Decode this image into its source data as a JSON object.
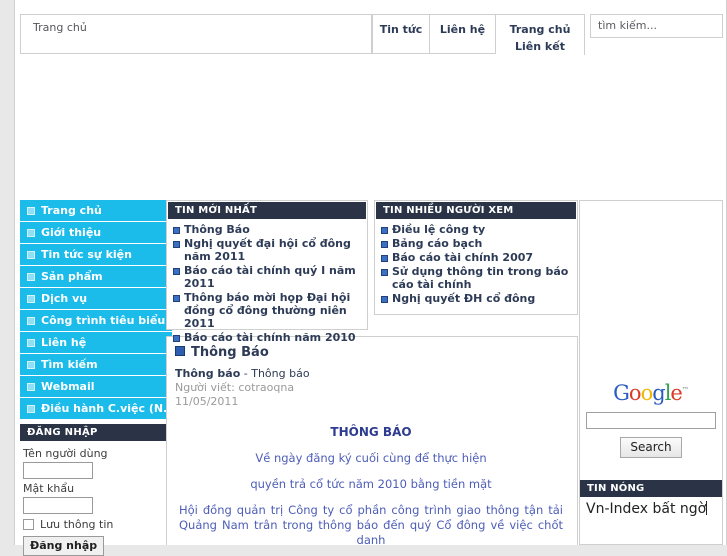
{
  "topbar": {
    "breadcrumb": "Trang chủ",
    "nav": [
      {
        "label": "Tin tức"
      },
      {
        "label": "Liên hệ"
      },
      {
        "label": "Trang chủ"
      },
      {
        "label": "Liên kết"
      }
    ],
    "search_placeholder": "tìm kiếm..."
  },
  "sidebar": {
    "items": [
      {
        "label": "Trang chủ"
      },
      {
        "label": "Giới thiệu"
      },
      {
        "label": "Tin tức sự kiện"
      },
      {
        "label": "Sản phẩm"
      },
      {
        "label": "Dịch vụ"
      },
      {
        "label": "Công trình tiêu biểu"
      },
      {
        "label": "Liên hệ"
      },
      {
        "label": "Tìm kiếm"
      },
      {
        "label": "Webmail"
      },
      {
        "label": "Điều hành C.việc (N.bộ)"
      }
    ],
    "login": {
      "header": "ĐĂNG NHẬP",
      "username_label": "Tên người dùng",
      "username_value": "",
      "password_label": "Mật khẩu",
      "password_value": "",
      "remember_label": "Lưu thông tin",
      "submit_label": "Đăng nhập"
    }
  },
  "panels": {
    "latest": {
      "header": "TIN MỚI NHẤT",
      "items": [
        "Thông Báo",
        "Nghị quyết đại hội cổ đông năm 2011",
        "Báo cáo tài chính quý I năm 2011",
        "Thông báo mời họp Đại hội đồng cổ đông thường niên 2011",
        "Báo cáo tài chính năm 2010"
      ]
    },
    "popular": {
      "header": "TIN NHIỀU NGƯỜI XEM",
      "items": [
        "Điều lệ công ty",
        "Bảng cáo bạch",
        "Báo cáo tài chính 2007",
        "Sử dụng thông tin trong báo cáo tài chính",
        "Nghị quyết ĐH cổ đông"
      ]
    }
  },
  "article": {
    "title": "Thông Báo",
    "category_bold": "Thông báo",
    "category_rest": " - Thông báo",
    "author": "Người viết: cotraoqna",
    "date": "11/05/2011",
    "body_title": "THÔNG BÁO",
    "body_line1": "Về ngày đăng ký cuối cùng để thực hiện",
    "body_line2": "quyền trả cổ tức năm 2010 bằng tiền mặt",
    "body_paragraph": "Hội đồng quản trị Công ty cổ phần công trình giao thông tận tải Quảng Nam trân trong thông báo đến quý Cổ đông về việc chốt danh"
  },
  "right": {
    "google_logo": {
      "g1": "G",
      "o1": "o",
      "o2": "o",
      "g2": "g",
      "l": "l",
      "e": "e",
      "tm": "™"
    },
    "search_value": "",
    "search_button": "Search",
    "hot_header": "TIN NÓNG",
    "hot_text": "Vn-Index bất ngờ"
  }
}
